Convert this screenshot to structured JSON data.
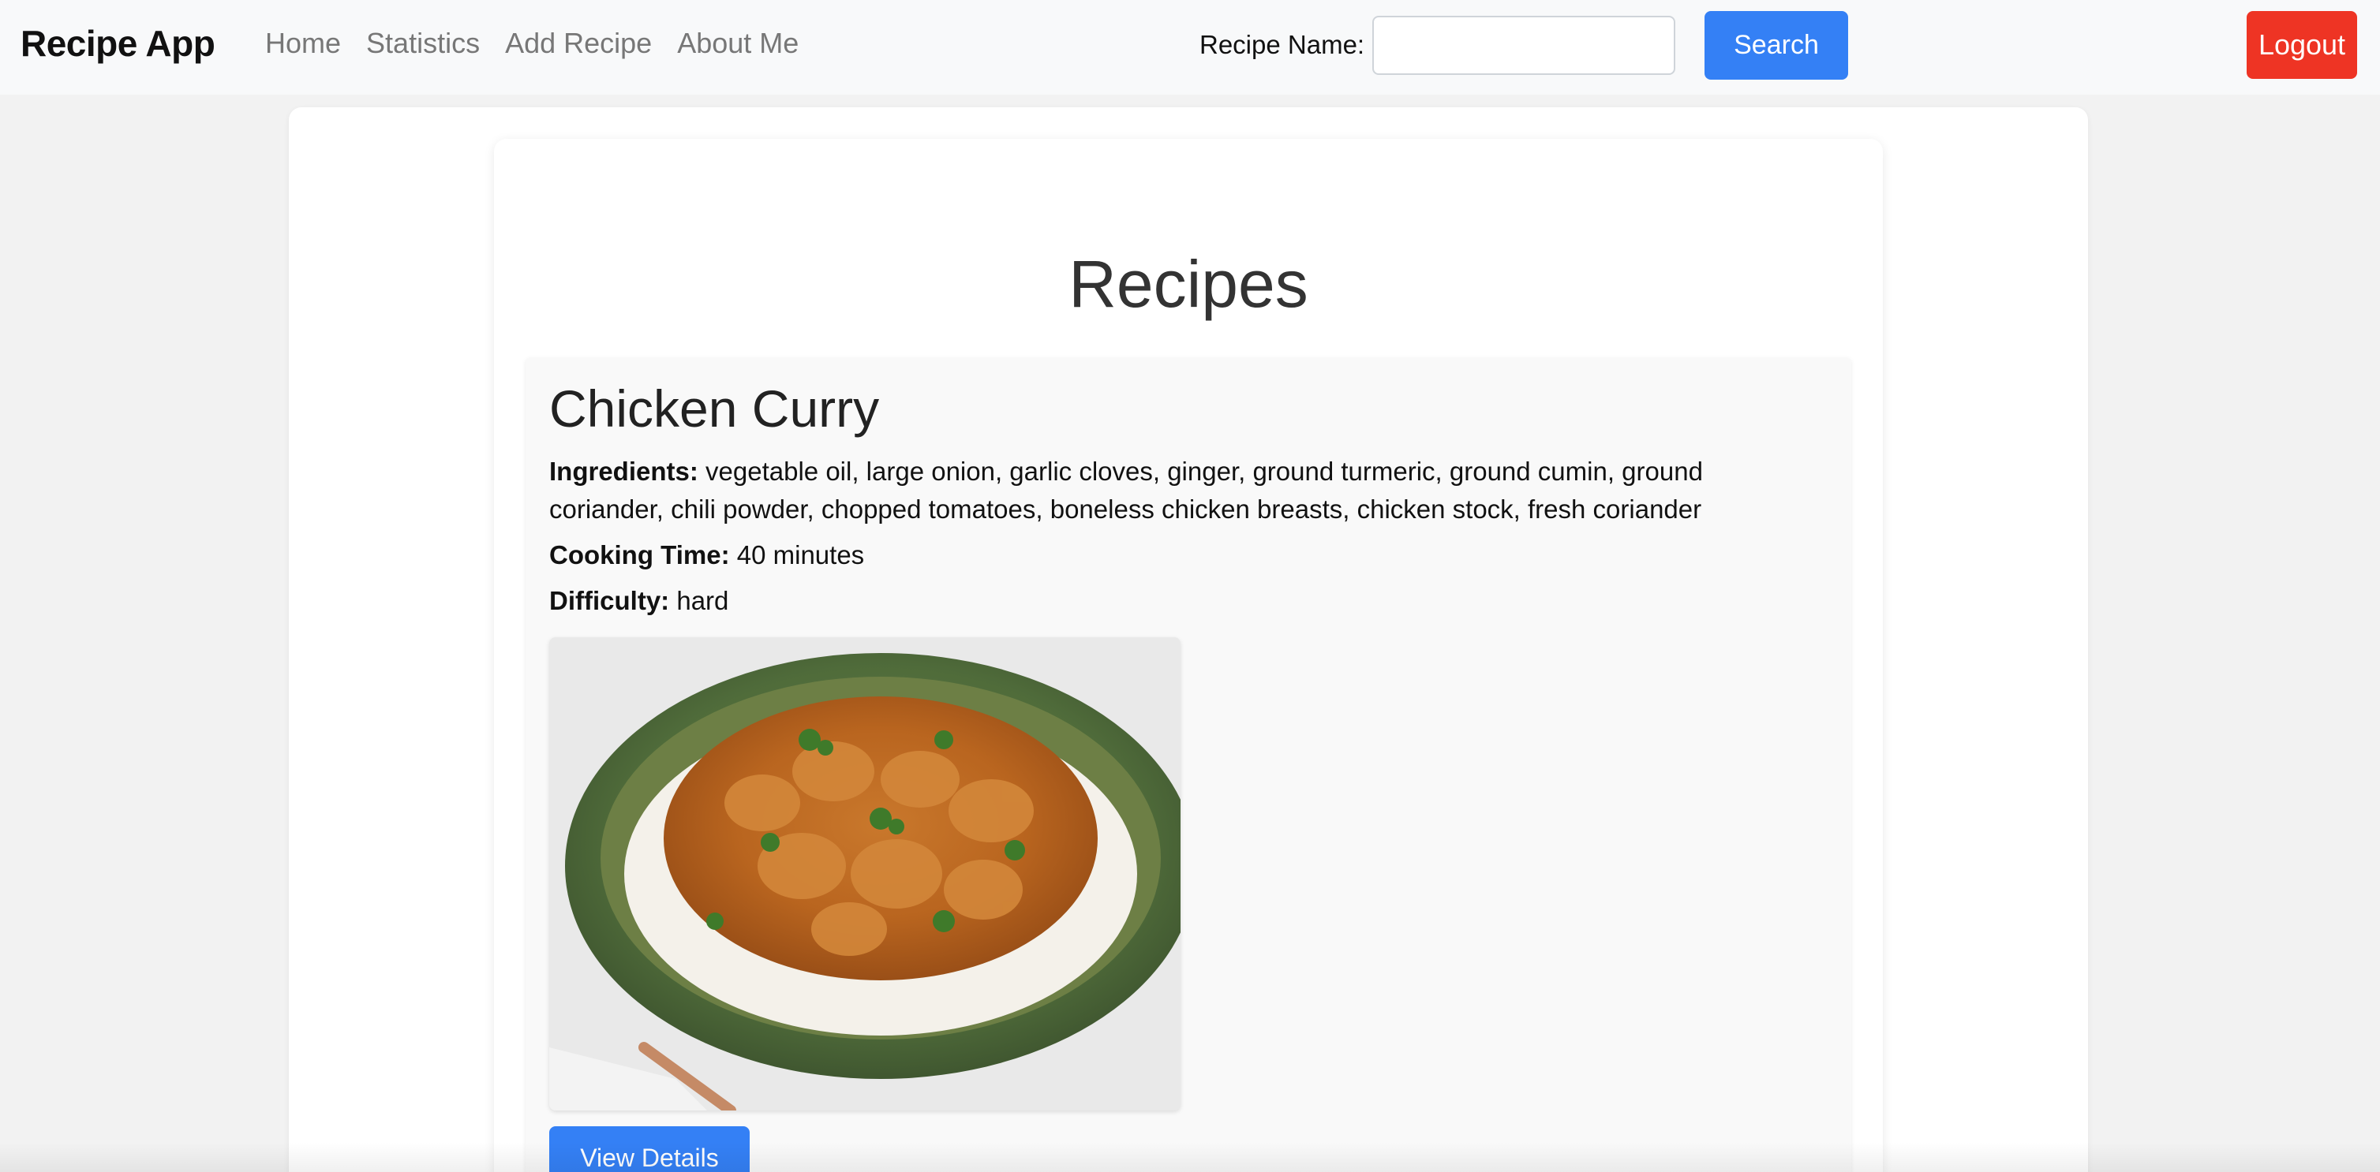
{
  "navbar": {
    "brand": "Recipe App",
    "links": [
      "Home",
      "Statistics",
      "Add Recipe",
      "About Me"
    ],
    "search_label": "Recipe Name:",
    "search_value": "",
    "search_button": "Search",
    "logout_button": "Logout"
  },
  "colors": {
    "primary": "#3480f5",
    "danger": "#ee3424",
    "navbar_bg": "#f8f9fa",
    "page_bg": "#f2f2f2"
  },
  "main": {
    "title": "Recipes",
    "recipes": [
      {
        "name": "Chicken Curry",
        "ingredients_label": "Ingredients:",
        "ingredients": "vegetable oil, large onion, garlic cloves, ginger, ground turmeric, ground cumin, ground coriander, chili powder, chopped tomatoes, boneless chicken breasts, chicken stock, fresh coriander",
        "cooking_time_label": "Cooking Time:",
        "cooking_time": "40 minutes",
        "difficulty_label": "Difficulty:",
        "difficulty": "hard",
        "image_alt": "chicken-curry-photo",
        "details_button": "View Details"
      }
    ]
  }
}
